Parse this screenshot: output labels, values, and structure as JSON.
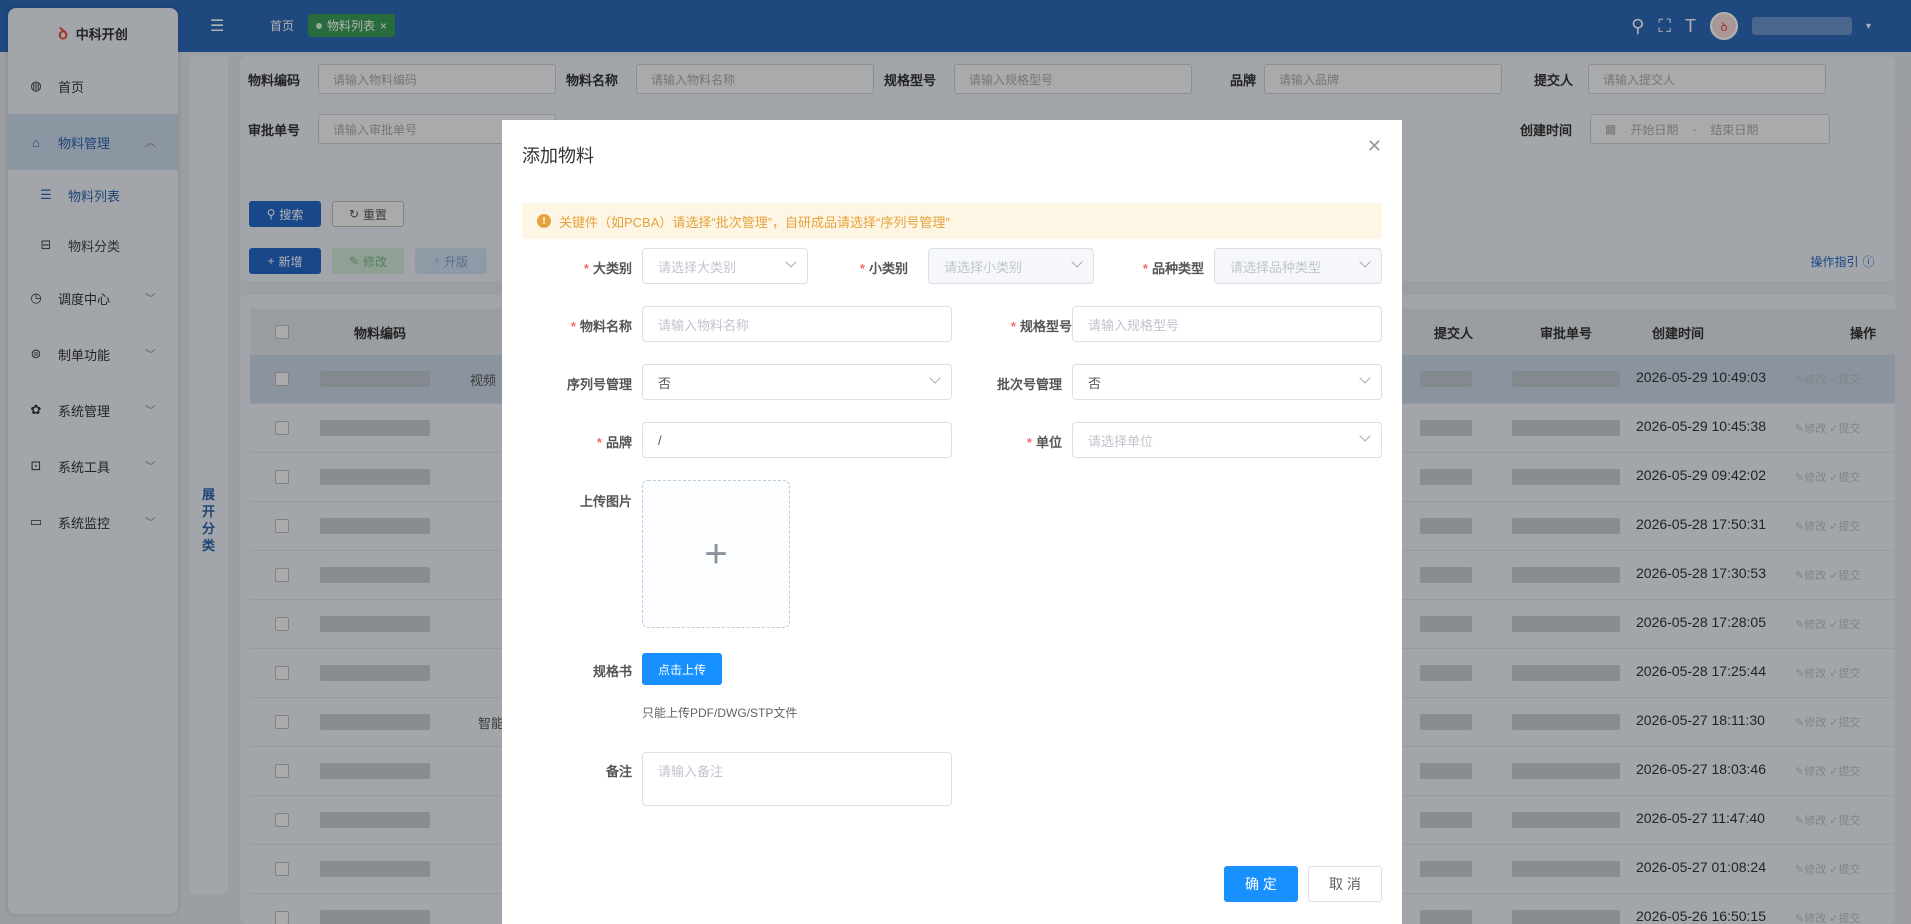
{
  "app": {
    "name": "中科开创",
    "user_name": ""
  },
  "tabs": {
    "home": "首页",
    "current": "物料列表",
    "close": "×"
  },
  "sidebar": {
    "items": [
      {
        "label": "首页",
        "icon": "dashboard-icon"
      },
      {
        "label": "物料管理",
        "icon": "home-icon",
        "active": true
      },
      {
        "label": "物料列表",
        "icon": "list-icon",
        "sub": true,
        "active": true
      },
      {
        "label": "物料分类",
        "icon": "tree-icon",
        "sub": true
      },
      {
        "label": "调度中心",
        "icon": "clock-icon"
      },
      {
        "label": "制单功能",
        "icon": "form-icon"
      },
      {
        "label": "系统管理",
        "icon": "gear-icon"
      },
      {
        "label": "系统工具",
        "icon": "tool-icon"
      },
      {
        "label": "系统监控",
        "icon": "monitor-icon"
      }
    ]
  },
  "expand_label": "展开分类",
  "filters": {
    "code": {
      "label": "物料编码",
      "placeholder": "请输入物料编码"
    },
    "name": {
      "label": "物料名称",
      "placeholder": "请输入物料名称"
    },
    "spec": {
      "label": "规格型号",
      "placeholder": "请输入规格型号"
    },
    "brand": {
      "label": "品牌",
      "placeholder": "请输入品牌"
    },
    "submitter": {
      "label": "提交人",
      "placeholder": "请输入提交人"
    },
    "approval": {
      "label": "审批单号",
      "placeholder": "请输入审批单号"
    },
    "created": {
      "label": "创建时间",
      "start": "开始日期",
      "sep": "-",
      "end": "结束日期"
    }
  },
  "buttons": {
    "search": "搜索",
    "reset": "重置",
    "add": "新增",
    "edit": "修改",
    "upgrade": "升版",
    "guide": "操作指引"
  },
  "table": {
    "headers": {
      "code": "物料编码",
      "submitter": "提交人",
      "approval": "审批单号",
      "created": "创建时间",
      "ops": "操作"
    },
    "visible_fragments": [
      "视频",
      "智能"
    ],
    "action_edit": "修改",
    "action_submit": "提交",
    "rows": [
      "2026-05-29 10:49:03",
      "2026-05-29 10:45:38",
      "2026-05-29 09:42:02",
      "2026-05-28 17:50:31",
      "2026-05-28 17:30:53",
      "2026-05-28 17:28:05",
      "2026-05-28 17:25:44",
      "2026-05-27 18:11:30",
      "2026-05-27 18:03:46",
      "2026-05-27 11:47:40",
      "2026-05-27 01:08:24",
      "2026-05-26 16:50:15"
    ]
  },
  "modal": {
    "title": "添加物料",
    "alert": "关键件（如PCBA）请选择“批次管理”，自研成品请选择“序列号管理”",
    "fields": {
      "major": {
        "label": "大类别",
        "placeholder": "请选择大类别"
      },
      "minor": {
        "label": "小类别",
        "placeholder": "请选择小类别"
      },
      "variety": {
        "label": "品种类型",
        "placeholder": "请选择品种类型"
      },
      "name": {
        "label": "物料名称",
        "placeholder": "请输入物料名称"
      },
      "spec": {
        "label": "规格型号",
        "placeholder": "请输入规格型号"
      },
      "serial": {
        "label": "序列号管理",
        "value": "否"
      },
      "batch": {
        "label": "批次号管理",
        "value": "否"
      },
      "brand": {
        "label": "品牌",
        "value": "/"
      },
      "unit": {
        "label": "单位",
        "placeholder": "请选择单位"
      },
      "image": {
        "label": "上传图片"
      },
      "manual": {
        "label": "规格书",
        "button": "点击上传",
        "tip": "只能上传PDF/DWG/STP文件"
      },
      "remark": {
        "label": "备注",
        "placeholder": "请输入备注"
      }
    },
    "confirm": "确 定",
    "cancel": "取 消"
  }
}
